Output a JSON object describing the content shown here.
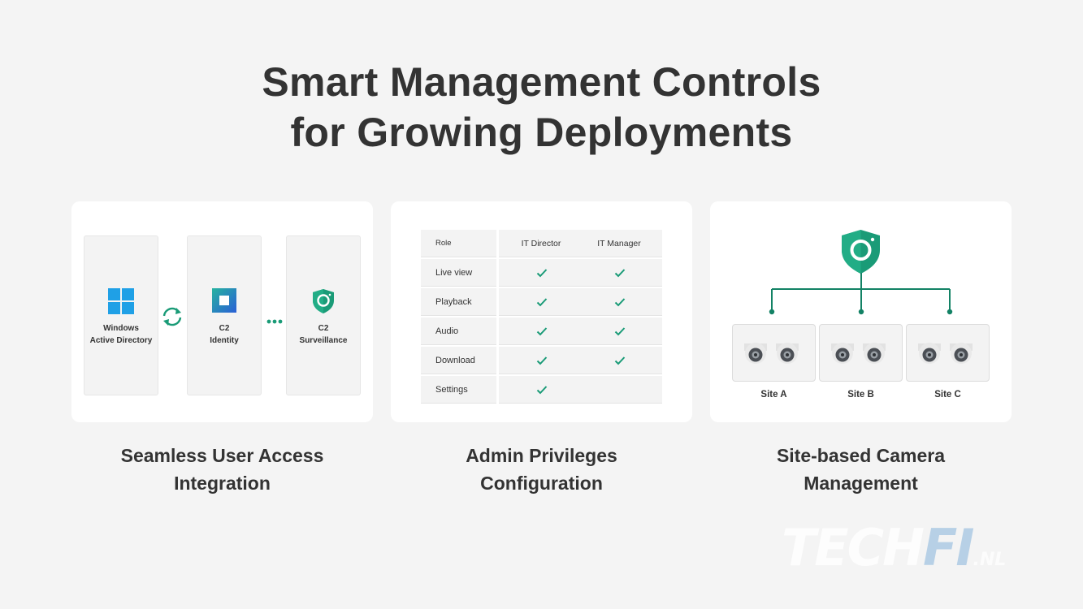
{
  "headline": {
    "line1": "Smart Management Controls",
    "line2": "for Growing Deployments"
  },
  "card1": {
    "panels": [
      {
        "line1": "Windows",
        "line2": "Active Directory",
        "icon": "windows-logo-icon"
      },
      {
        "line1": "C2",
        "line2": "Identity",
        "icon": "c2-identity-icon"
      },
      {
        "line1": "C2",
        "line2": "Surveillance",
        "icon": "c2-surveillance-shield-icon"
      }
    ],
    "caption_line1": "Seamless User Access",
    "caption_line2": "Integration"
  },
  "card2": {
    "headers": [
      "Role",
      "IT Director",
      "IT Manager"
    ],
    "rows": [
      {
        "label": "Live view",
        "it_director": true,
        "it_manager": true
      },
      {
        "label": "Playback",
        "it_director": true,
        "it_manager": true
      },
      {
        "label": "Audio",
        "it_director": true,
        "it_manager": true
      },
      {
        "label": "Download",
        "it_director": true,
        "it_manager": true
      },
      {
        "label": "Settings",
        "it_director": true,
        "it_manager": false
      }
    ],
    "caption_line1": "Admin Privileges",
    "caption_line2": "Configuration"
  },
  "card3": {
    "sites": [
      "Site A",
      "Site B",
      "Site C"
    ],
    "caption_line1": "Site-based Camera",
    "caption_line2": "Management"
  },
  "watermark": {
    "part1": "TECH",
    "part2": "FI",
    "part3": ".NL"
  },
  "colors": {
    "accent": "#1a9b77",
    "accent_dark": "#138265",
    "windows_blue": "#1fa0e6",
    "identity_blue": "#2a6fd6"
  }
}
